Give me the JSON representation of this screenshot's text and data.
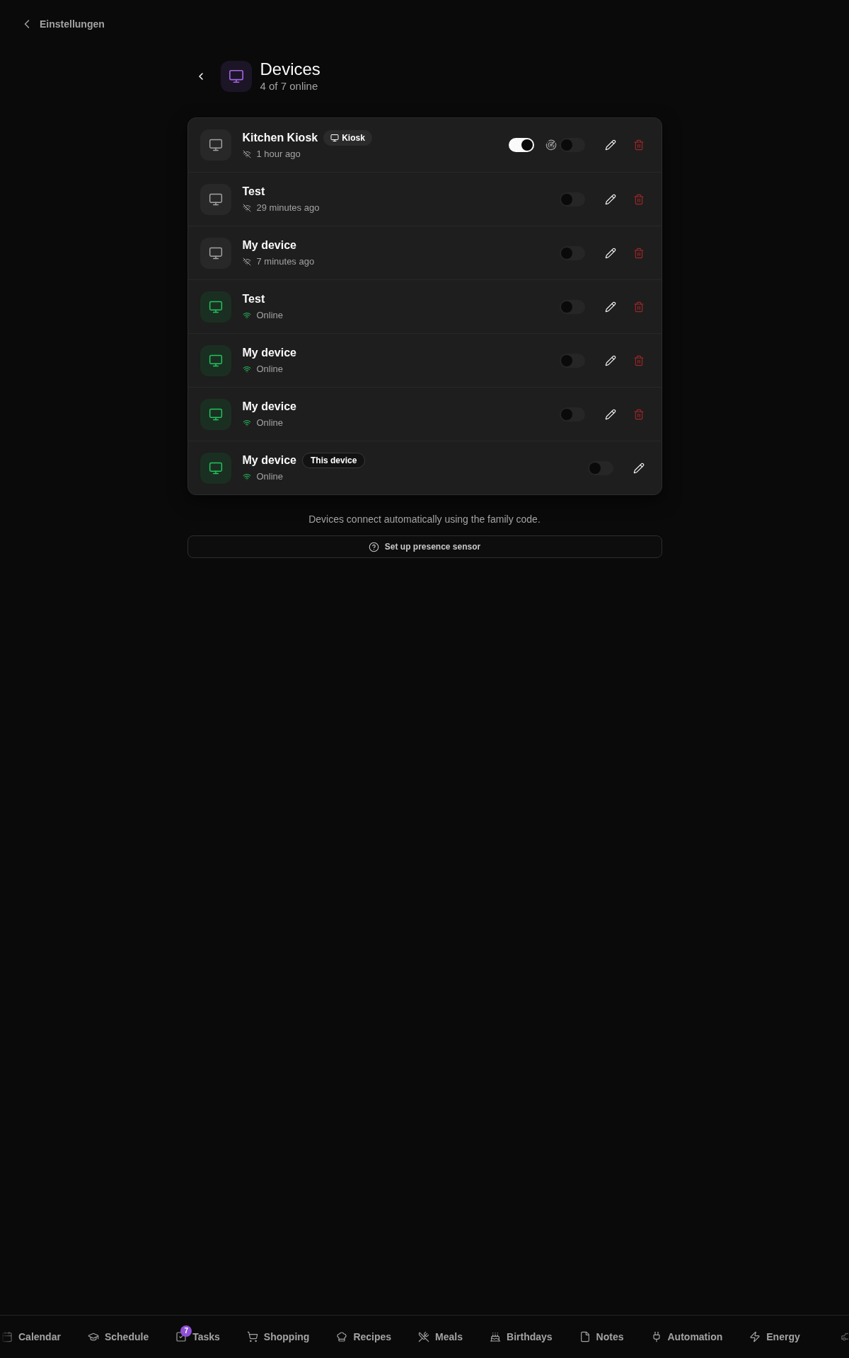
{
  "back_link": {
    "label": "Einstellungen"
  },
  "header": {
    "title": "Devices",
    "subtitle": "4 of 7 online"
  },
  "devices": [
    {
      "name": "Kitchen Kiosk",
      "badge": {
        "kind": "kiosk",
        "label": "Kiosk"
      },
      "online": false,
      "status": "1 hour ago",
      "switches": [
        {
          "kind": "plain",
          "on": true
        },
        {
          "kind": "sensor",
          "on": false
        }
      ],
      "deletable": true
    },
    {
      "name": "Test",
      "online": false,
      "status": "29 minutes ago",
      "switches": [
        {
          "kind": "plain",
          "on": false
        }
      ],
      "deletable": true
    },
    {
      "name": "My device",
      "online": false,
      "status": "7 minutes ago",
      "switches": [
        {
          "kind": "plain",
          "on": false
        }
      ],
      "deletable": true
    },
    {
      "name": "Test",
      "online": true,
      "status": "Online",
      "switches": [
        {
          "kind": "plain",
          "on": false
        }
      ],
      "deletable": true
    },
    {
      "name": "My device",
      "online": true,
      "status": "Online",
      "switches": [
        {
          "kind": "plain",
          "on": false
        }
      ],
      "deletable": true
    },
    {
      "name": "My device",
      "online": true,
      "status": "Online",
      "switches": [
        {
          "kind": "plain",
          "on": false
        }
      ],
      "deletable": true
    },
    {
      "name": "My device",
      "badge": {
        "kind": "current",
        "label": "This device"
      },
      "online": true,
      "status": "Online",
      "switches": [
        {
          "kind": "plain",
          "on": false
        }
      ],
      "deletable": false
    }
  ],
  "note": "Devices connect automatically using the family code.",
  "presence_button": {
    "label": "Set up presence sensor"
  },
  "bottom_nav": {
    "items": [
      {
        "label": "Calendar"
      },
      {
        "label": "Schedule"
      },
      {
        "label": "Tasks",
        "badge": "7"
      },
      {
        "label": "Shopping"
      },
      {
        "label": "Recipes"
      },
      {
        "label": "Meals"
      },
      {
        "label": "Birthdays"
      },
      {
        "label": "Notes"
      },
      {
        "label": "Automation"
      },
      {
        "label": "Energy"
      }
    ]
  }
}
